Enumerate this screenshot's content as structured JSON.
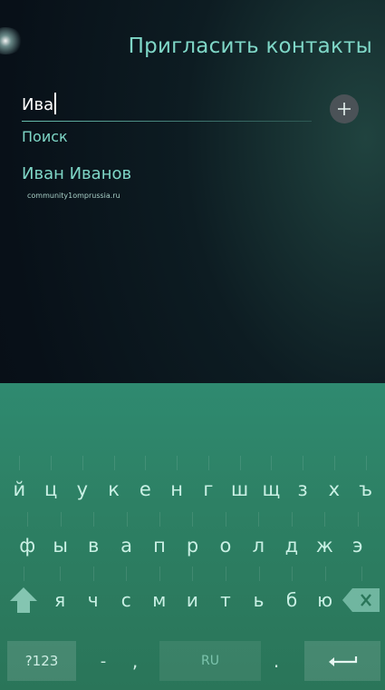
{
  "header": {
    "title": "Пригласить контакты"
  },
  "search": {
    "value": "Ива",
    "label": "Поиск"
  },
  "results": [
    {
      "name": "Иван Иванов",
      "detail": "community1omprussia.ru"
    }
  ],
  "keyboard": {
    "row1": [
      "й",
      "ц",
      "у",
      "к",
      "е",
      "н",
      "г",
      "ш",
      "щ",
      "з",
      "х",
      "ъ"
    ],
    "row2": [
      "ф",
      "ы",
      "в",
      "а",
      "п",
      "р",
      "о",
      "л",
      "д",
      "ж",
      "э"
    ],
    "row3": [
      "я",
      "ч",
      "с",
      "м",
      "и",
      "т",
      "ь",
      "б",
      "ю"
    ],
    "symbols_label": "?123",
    "dash": "-",
    "comma": ",",
    "space_label": "RU",
    "period": ".",
    "icons": {
      "shift": "shift-arrow-icon",
      "backspace": "backspace-icon",
      "enter": "enter-icon",
      "add": "plus-icon"
    }
  },
  "colors": {
    "accent": "#7fd7c7",
    "keyboard": "#2d8064",
    "background": "#081018"
  }
}
